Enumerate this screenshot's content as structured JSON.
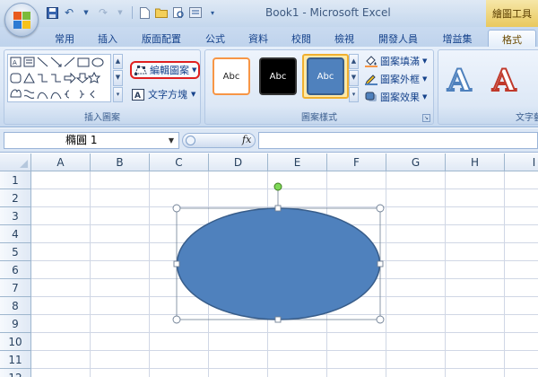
{
  "title_bar": {
    "title": "Book1 - Microsoft Excel",
    "context_group": "繪圖工具"
  },
  "tabs": [
    {
      "label": "常用"
    },
    {
      "label": "插入"
    },
    {
      "label": "版面配置"
    },
    {
      "label": "公式"
    },
    {
      "label": "資料"
    },
    {
      "label": "校閱"
    },
    {
      "label": "檢視"
    },
    {
      "label": "開發人員"
    },
    {
      "label": "增益集"
    },
    {
      "label": "格式"
    }
  ],
  "active_tab": "格式",
  "ribbon": {
    "insert_shapes": {
      "group_label": "插入圖案",
      "edit_shape_label": "編輯圖案",
      "text_box_label": "文字方塊"
    },
    "shape_styles": {
      "group_label": "圖案樣式",
      "swatch_text": "Abc",
      "fill_label": "圖案填滿",
      "outline_label": "圖案外框",
      "effects_label": "圖案效果"
    },
    "wordart": {
      "group_label": "文字藝",
      "sample": "A"
    }
  },
  "formula_bar": {
    "name_box": "橢圓 1",
    "fx_label": "fx",
    "value": ""
  },
  "sheet": {
    "columns": [
      "A",
      "B",
      "C",
      "D",
      "E",
      "F",
      "G",
      "H",
      "I"
    ],
    "rows": [
      "1",
      "2",
      "3",
      "4",
      "5",
      "6",
      "7",
      "8",
      "9",
      "10",
      "11",
      "12"
    ]
  },
  "colors": {
    "shape_fill": "#4f81bd",
    "shape_outline": "#385d8a",
    "selection_handle": "#ffffff",
    "rotation_handle": "#7ed957",
    "highlight_red": "#e02020"
  }
}
